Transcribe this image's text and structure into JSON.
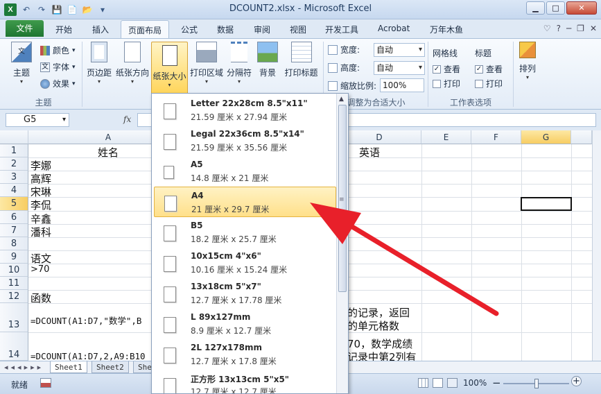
{
  "window": {
    "title": "DCOUNT2.xlsx - Microsoft Excel",
    "app_icon": "X",
    "minimize": "▁",
    "maximize": "□",
    "close": "✕"
  },
  "qat_icons": [
    "↶",
    "↷",
    "💾",
    "📄",
    "📂",
    "▾"
  ],
  "tabs": {
    "file": "文件",
    "items": [
      "开始",
      "插入",
      "页面布局",
      "公式",
      "数据",
      "审阅",
      "视图",
      "开发工具",
      "Acrobat",
      "万年木鱼"
    ],
    "active_index": 2,
    "right": [
      "♡",
      "?",
      "─",
      "❐",
      "✕"
    ]
  },
  "ribbon": {
    "theme_group": {
      "label": "主题",
      "themes": "主题",
      "colors": "颜色",
      "fonts": "字体",
      "effects": "效果"
    },
    "page_setup": {
      "margins": "页边距",
      "orientation": "纸张方向",
      "size": "纸张大小",
      "print_area": "打印区域",
      "breaks": "分隔符",
      "background": "背景",
      "print_titles": "打印标题"
    },
    "scale": {
      "label": "调整为合适大小",
      "width_label": "宽度:",
      "width_value": "自动",
      "height_label": "高度:",
      "height_value": "自动",
      "scale_label": "缩放比例:",
      "scale_value": "100%"
    },
    "sheet_options": {
      "label": "工作表选项",
      "gridlines": "网格线",
      "headings": "标题",
      "view": "查看",
      "print": "打印"
    },
    "arrange": {
      "label": "排列"
    }
  },
  "formula_bar": {
    "name_box": "G5",
    "fx": "fx",
    "formula": ""
  },
  "sheet": {
    "columns": [
      "A",
      "B",
      "C",
      "D",
      "E",
      "F",
      "G"
    ],
    "selected_column": "G",
    "rows": [
      "1",
      "2",
      "3",
      "4",
      "5",
      "6",
      "7",
      "8",
      "9",
      "10",
      "11",
      "12",
      "13",
      "14"
    ],
    "selected_row": "5",
    "cells": {
      "A1": "姓名",
      "A2": "李娜",
      "A3": "高辉",
      "A4": "宋琳",
      "A5": "李侃",
      "A6": "辛鑫",
      "A7": "潘科",
      "A9": "语文",
      "A10": ">70",
      "A12": "函数",
      "A13": "=DCOUNT(A1:D7,\"数学\",B",
      "A14": "=DCOUNT(A1:D7,2,A9:B10",
      "D1": "英语",
      "D13_line1": "的记录，返回",
      "D13_line2": "的单元格数",
      "D14_line1": "70，数学成绩",
      "D14_line2": "记录中第2列有"
    },
    "sheet_tabs": [
      "Sheet1",
      "Sheet2",
      "She"
    ],
    "nav_arrows": "◂◂◂▸▸▸"
  },
  "status_bar": {
    "ready": "就绪",
    "zoom": "100%",
    "minus": "−",
    "plus": "+"
  },
  "paper_sizes": [
    {
      "name": "Letter 22x28cm 8.5\"x11\"",
      "dims": "21.59 厘米 x 27.94 厘米"
    },
    {
      "name": "Legal 22x36cm 8.5\"x14\"",
      "dims": "21.59 厘米 x 35.56 厘米"
    },
    {
      "name": "A5",
      "dims": "14.8 厘米 x 21 厘米"
    },
    {
      "name": "A4",
      "dims": "21 厘米 x 29.7 厘米"
    },
    {
      "name": "B5",
      "dims": "18.2 厘米 x 25.7 厘米"
    },
    {
      "name": "10x15cm 4\"x6\"",
      "dims": "10.16 厘米 x 15.24 厘米"
    },
    {
      "name": "13x18cm 5\"x7\"",
      "dims": "12.7 厘米 x 17.78 厘米"
    },
    {
      "name": "L 89x127mm",
      "dims": "8.9 厘米 x 12.7 厘米"
    },
    {
      "name": "2L 127x178mm",
      "dims": "12.7 厘米 x 17.8 厘米"
    },
    {
      "name": "正方形 13x13cm 5\"x5\"",
      "dims": "12.7 厘米 x 12.7 厘米"
    }
  ],
  "highlighted_paper_index": 3,
  "colors": {
    "file_tab": "#1f7631",
    "highlight": "#ffe08a",
    "arrow": "#e8202a"
  }
}
